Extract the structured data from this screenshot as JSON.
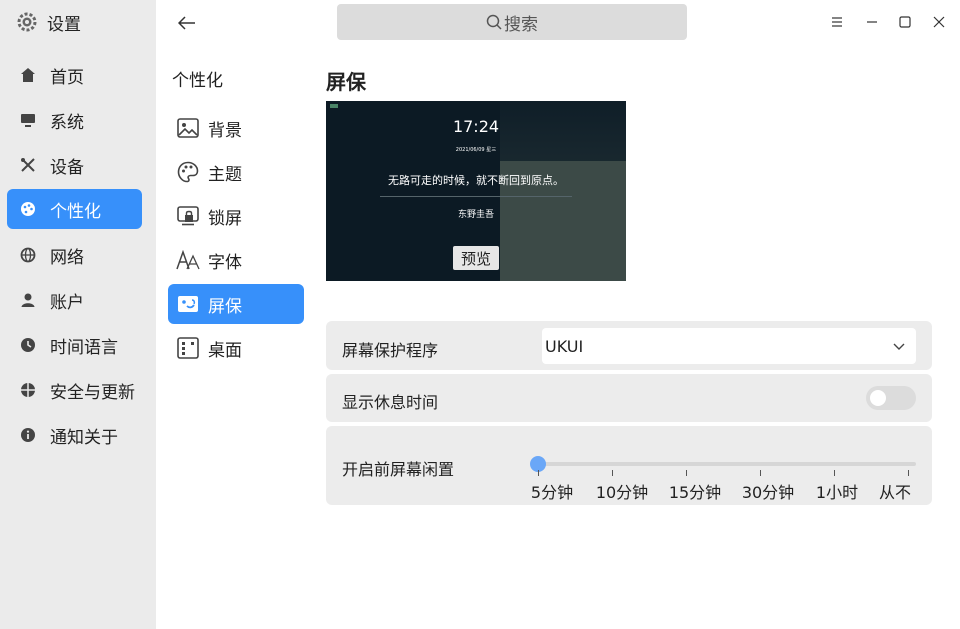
{
  "app": {
    "title": "设置"
  },
  "sidebar": {
    "items": [
      {
        "label": "首页",
        "icon": "home-icon"
      },
      {
        "label": "系统",
        "icon": "monitor-icon"
      },
      {
        "label": "设备",
        "icon": "tools-icon"
      },
      {
        "label": "个性化",
        "icon": "palette-icon",
        "active": true
      },
      {
        "label": "网络",
        "icon": "globe-icon"
      },
      {
        "label": "账户",
        "icon": "user-icon"
      },
      {
        "label": "时间语言",
        "icon": "clock-icon"
      },
      {
        "label": "安全与更新",
        "icon": "shield-icon"
      },
      {
        "label": "通知关于",
        "icon": "info-icon"
      }
    ]
  },
  "subnav": {
    "title": "个性化",
    "items": [
      {
        "label": "背景",
        "icon": "image-icon"
      },
      {
        "label": "主题",
        "icon": "palette-icon"
      },
      {
        "label": "锁屏",
        "icon": "lockscreen-icon"
      },
      {
        "label": "字体",
        "icon": "font-icon"
      },
      {
        "label": "屏保",
        "icon": "screensaver-icon",
        "active": true
      },
      {
        "label": "桌面",
        "icon": "desktop-icon"
      }
    ]
  },
  "search": {
    "placeholder": "搜索"
  },
  "page": {
    "title": "屏保"
  },
  "preview": {
    "time": "17:24",
    "date": "2021/06/09 星三",
    "quote": "无路可走的时候，就不断回到原点。",
    "author": "东野圭吾",
    "button_label": "预览"
  },
  "settings": {
    "screensaver_program": {
      "label": "屏幕保护程序",
      "value": "UKUI"
    },
    "show_rest_time": {
      "label": "显示休息时间",
      "enabled": false
    },
    "idle_before": {
      "label": "开启前屏幕闲置",
      "options": [
        "5分钟",
        "10分钟",
        "15分钟",
        "30分钟",
        "1小时",
        "从不"
      ],
      "selected_index": 0
    }
  },
  "colors": {
    "accent": "#3790fa",
    "sidebar_bg": "#ebebeb",
    "row_bg": "#ececec",
    "slider_handle": "#6aa7f7"
  }
}
